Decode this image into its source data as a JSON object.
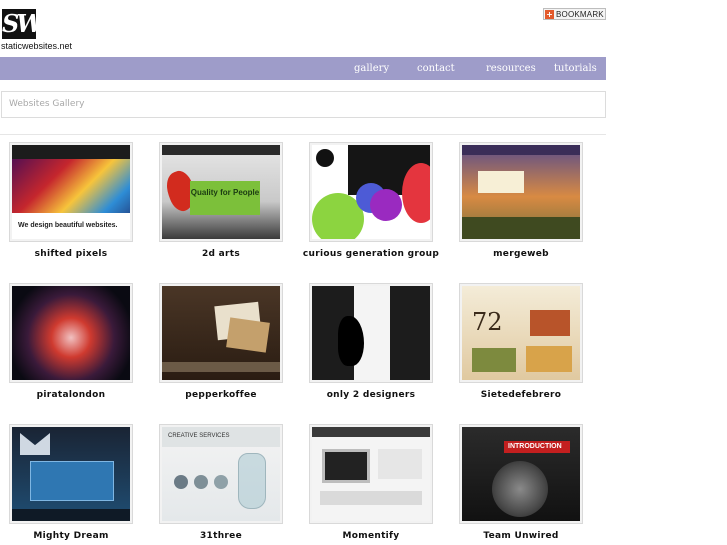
{
  "site": {
    "logo_text": "staticwebsites.net"
  },
  "bookmark": {
    "label": "BOOKMARK"
  },
  "nav": {
    "items": [
      "gallery",
      "contact",
      "resources",
      "tutorials"
    ]
  },
  "search": {
    "placeholder": "Websites Gallery"
  },
  "gallery": {
    "items": [
      {
        "label": "shifted pixels",
        "thumb_text": "We design beautiful websites."
      },
      {
        "label": "2d arts",
        "thumb_text": "Quality for People"
      },
      {
        "label": "curious generation group"
      },
      {
        "label": "mergeweb"
      },
      {
        "label": "piratalondon"
      },
      {
        "label": "pepperkoffee"
      },
      {
        "label": "only 2 designers"
      },
      {
        "label": "Sietedefebrero",
        "thumb_text": "72"
      },
      {
        "label": "Mighty Dream"
      },
      {
        "label": "31three",
        "thumb_text": "CREATIVE SERVICES"
      },
      {
        "label": "Momentify"
      },
      {
        "label": "Team Unwired",
        "thumb_text": "INTRODUCTION"
      }
    ]
  }
}
